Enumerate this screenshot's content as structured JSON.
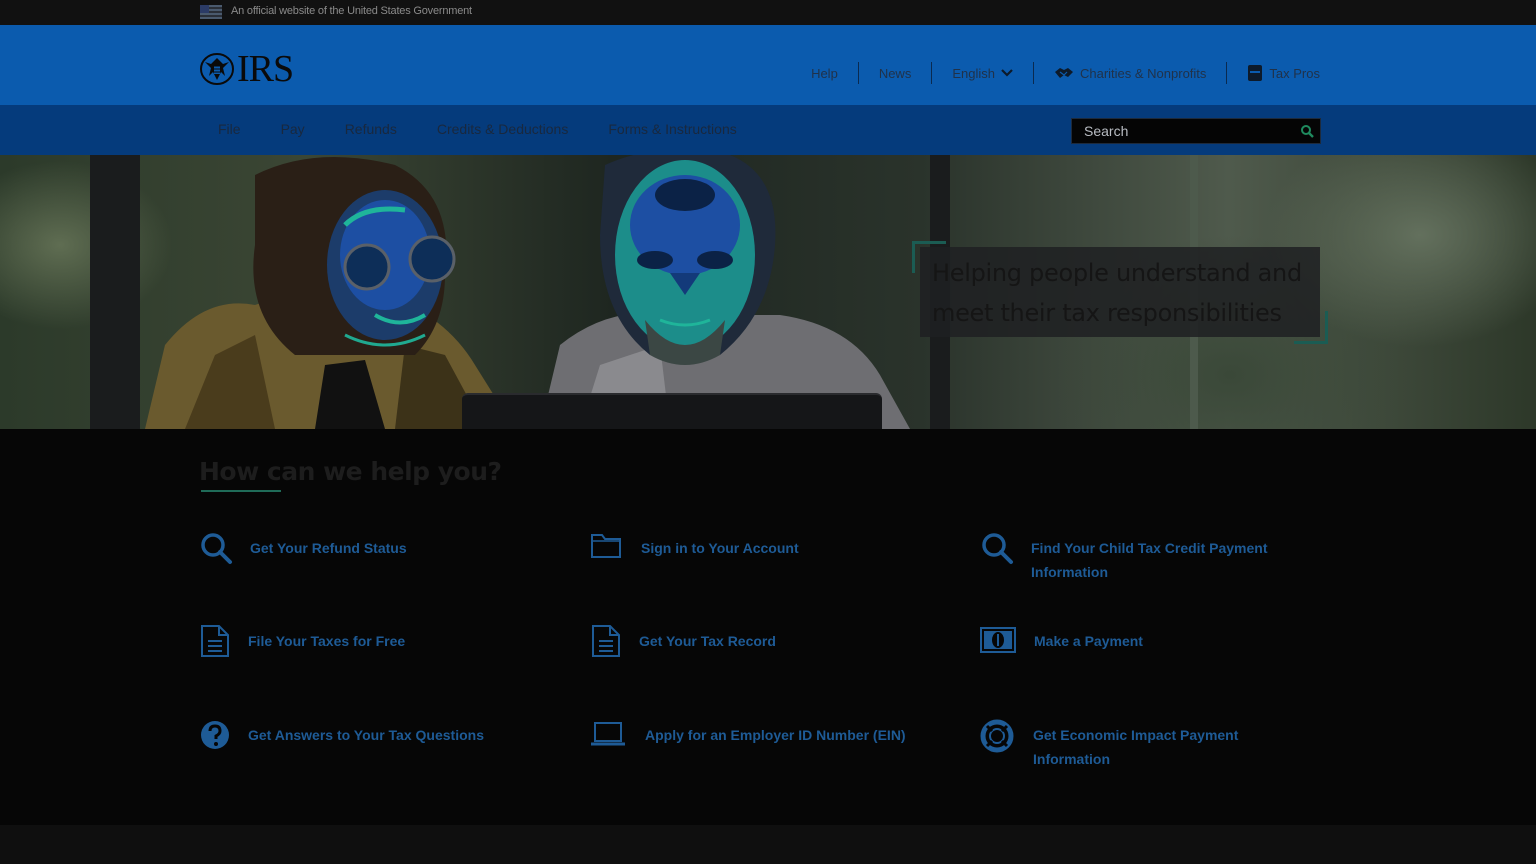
{
  "gov_banner": {
    "text": "An official website of the United States Government"
  },
  "header": {
    "logo_text": "IRS",
    "links": [
      {
        "label": "Help",
        "icon": ""
      },
      {
        "label": "News",
        "icon": ""
      },
      {
        "label": "English",
        "icon": "chevron-down-icon"
      },
      {
        "label": "Charities & Nonprofits",
        "icon": "handshake-icon"
      },
      {
        "label": "Tax Pros",
        "icon": "briefcase-icon"
      }
    ]
  },
  "nav": {
    "items": [
      "File",
      "Pay",
      "Refunds",
      "Credits & Deductions",
      "Forms & Instructions"
    ],
    "search_placeholder": "Search"
  },
  "hero": {
    "tagline": "Helping people understand and meet their tax responsibilities"
  },
  "help": {
    "title": "How can we help you?",
    "tiles": [
      {
        "label": "Get Your Refund Status",
        "icon": "search-icon"
      },
      {
        "label": "Sign in to Your Account",
        "icon": "folder-icon"
      },
      {
        "label": "Find Your Child Tax Credit Payment Information",
        "icon": "search-icon"
      },
      {
        "label": "File Your Taxes for Free",
        "icon": "document-icon"
      },
      {
        "label": "Get Your Tax Record",
        "icon": "document-icon"
      },
      {
        "label": "Make a Payment",
        "icon": "money-icon"
      },
      {
        "label": "Get Answers to Your Tax Questions",
        "icon": "question-icon"
      },
      {
        "label": "Apply for an Employer ID Number (EIN)",
        "icon": "laptop-icon"
      },
      {
        "label": "Get Economic Impact Payment Information",
        "icon": "lifebuoy-icon"
      }
    ]
  },
  "colors": {
    "header_blue": "#0b5bae",
    "nav_blue": "#053b7c",
    "link_blue": "#1e5b96",
    "accent_green": "#1f6b58"
  }
}
